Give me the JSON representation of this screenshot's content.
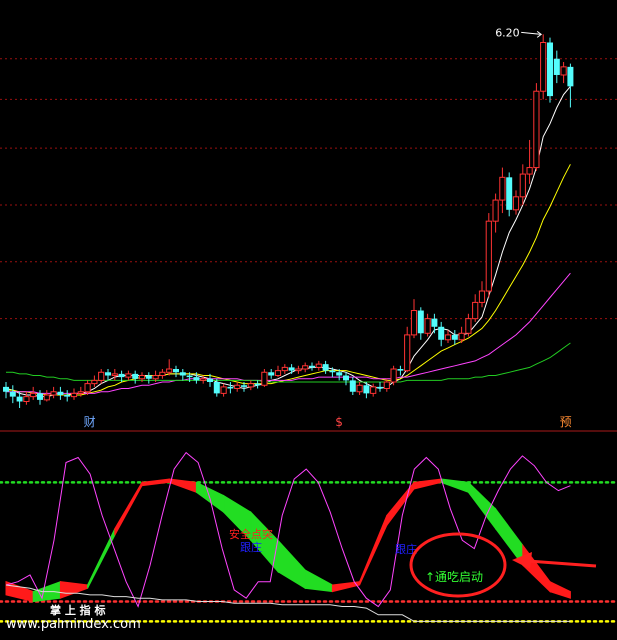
{
  "chart_data": [
    {
      "type": "candlestick",
      "title": "",
      "ylim": [
        3.9,
        6.35
      ],
      "y_gridlines": [
        4.45,
        4.8,
        5.15,
        5.5,
        5.8,
        6.05
      ],
      "high_label": "6.20",
      "candles": [
        [
          4.03,
          4.0,
          4.06,
          3.96
        ],
        [
          4.0,
          3.97,
          4.04,
          3.93
        ],
        [
          3.97,
          3.94,
          4.0,
          3.9
        ],
        [
          3.94,
          3.97,
          4.0,
          3.92
        ],
        [
          3.97,
          3.99,
          4.03,
          3.95
        ],
        [
          3.99,
          3.95,
          4.01,
          3.92
        ],
        [
          3.95,
          3.98,
          4.01,
          3.94
        ],
        [
          3.98,
          4.0,
          4.03,
          3.96
        ],
        [
          4.0,
          3.98,
          4.03,
          3.95
        ],
        [
          3.98,
          3.97,
          4.01,
          3.94
        ],
        [
          3.97,
          3.99,
          4.02,
          3.95
        ],
        [
          3.99,
          4.0,
          4.03,
          3.97
        ],
        [
          4.0,
          4.05,
          4.07,
          3.98
        ],
        [
          4.05,
          4.07,
          4.1,
          4.03
        ],
        [
          4.07,
          4.12,
          4.14,
          4.05
        ],
        [
          4.12,
          4.1,
          4.14,
          4.07
        ],
        [
          4.1,
          4.11,
          4.14,
          4.07
        ],
        [
          4.11,
          4.09,
          4.13,
          4.06
        ],
        [
          4.09,
          4.11,
          4.13,
          4.07
        ],
        [
          4.11,
          4.08,
          4.13,
          4.05
        ],
        [
          4.08,
          4.1,
          4.12,
          4.06
        ],
        [
          4.1,
          4.08,
          4.12,
          4.05
        ],
        [
          4.08,
          4.1,
          4.13,
          4.06
        ],
        [
          4.1,
          4.12,
          4.14,
          4.08
        ],
        [
          4.12,
          4.14,
          4.2,
          4.1
        ],
        [
          4.14,
          4.12,
          4.16,
          4.09
        ],
        [
          4.12,
          4.1,
          4.14,
          4.07
        ],
        [
          4.1,
          4.09,
          4.12,
          4.06
        ],
        [
          4.09,
          4.07,
          4.12,
          4.05
        ],
        [
          4.07,
          4.08,
          4.1,
          4.05
        ],
        [
          4.08,
          4.06,
          4.11,
          4.03
        ],
        [
          4.06,
          3.99,
          4.08,
          3.97
        ],
        [
          3.99,
          4.03,
          4.05,
          3.97
        ],
        [
          4.03,
          4.02,
          4.06,
          3.99
        ],
        [
          4.02,
          4.04,
          4.06,
          4.0
        ],
        [
          4.04,
          4.03,
          4.06,
          4.0
        ],
        [
          4.03,
          4.05,
          4.07,
          4.01
        ],
        [
          4.05,
          4.04,
          4.07,
          4.02
        ],
        [
          4.04,
          4.12,
          4.14,
          4.03
        ],
        [
          4.12,
          4.1,
          4.14,
          4.08
        ],
        [
          4.1,
          4.13,
          4.16,
          4.09
        ],
        [
          4.13,
          4.15,
          4.17,
          4.11
        ],
        [
          4.15,
          4.13,
          4.17,
          4.11
        ],
        [
          4.13,
          4.14,
          4.16,
          4.11
        ],
        [
          4.14,
          4.16,
          4.18,
          4.12
        ],
        [
          4.16,
          4.15,
          4.18,
          4.13
        ],
        [
          4.15,
          4.17,
          4.19,
          4.13
        ],
        [
          4.17,
          4.13,
          4.19,
          4.11
        ],
        [
          4.13,
          4.12,
          4.15,
          4.09
        ],
        [
          4.12,
          4.1,
          4.14,
          4.07
        ],
        [
          4.1,
          4.07,
          4.12,
          4.04
        ],
        [
          4.07,
          4.0,
          4.09,
          3.98
        ],
        [
          4.0,
          4.04,
          4.06,
          3.98
        ],
        [
          4.04,
          3.99,
          4.06,
          3.96
        ],
        [
          3.99,
          4.03,
          4.05,
          3.97
        ],
        [
          4.03,
          4.02,
          4.06,
          4.0
        ],
        [
          4.02,
          4.06,
          4.08,
          4.0
        ],
        [
          4.06,
          4.14,
          4.16,
          4.04
        ],
        [
          4.14,
          4.13,
          4.16,
          4.1
        ],
        [
          4.13,
          4.35,
          4.4,
          4.12
        ],
        [
          4.35,
          4.5,
          4.57,
          4.33
        ],
        [
          4.5,
          4.36,
          4.52,
          4.32
        ],
        [
          4.36,
          4.45,
          4.48,
          4.34
        ],
        [
          4.45,
          4.4,
          4.48,
          4.36
        ],
        [
          4.4,
          4.32,
          4.43,
          4.28
        ],
        [
          4.32,
          4.35,
          4.38,
          4.3
        ],
        [
          4.35,
          4.32,
          4.38,
          4.29
        ],
        [
          4.32,
          4.36,
          4.4,
          4.3
        ],
        [
          4.36,
          4.45,
          4.48,
          4.34
        ],
        [
          4.45,
          4.55,
          4.6,
          4.43
        ],
        [
          4.55,
          4.62,
          4.68,
          4.52
        ],
        [
          4.62,
          5.05,
          5.1,
          4.58
        ],
        [
          5.05,
          5.18,
          5.22,
          4.98
        ],
        [
          5.18,
          5.32,
          5.38,
          5.1
        ],
        [
          5.32,
          5.12,
          5.35,
          5.08
        ],
        [
          5.12,
          5.2,
          5.24,
          5.09
        ],
        [
          5.2,
          5.34,
          5.4,
          5.15
        ],
        [
          5.34,
          5.38,
          5.55,
          5.28
        ],
        [
          5.38,
          5.85,
          5.9,
          5.36
        ],
        [
          5.85,
          6.15,
          6.2,
          5.8
        ],
        [
          6.15,
          5.82,
          6.18,
          5.78
        ],
        [
          6.05,
          5.95,
          6.1,
          5.9
        ],
        [
          5.95,
          6.0,
          6.03,
          5.9
        ],
        [
          6.0,
          5.88,
          6.02,
          5.75
        ]
      ],
      "ma_lines": [
        {
          "color": "#ffffff",
          "values": [
            4.02,
            4.01,
            3.99,
            3.98,
            3.98,
            3.97,
            3.97,
            3.98,
            3.98,
            3.98,
            3.99,
            3.99,
            4.0,
            4.02,
            4.05,
            4.07,
            4.09,
            4.1,
            4.1,
            4.1,
            4.1,
            4.1,
            4.1,
            4.1,
            4.11,
            4.11,
            4.11,
            4.11,
            4.1,
            4.09,
            4.08,
            4.06,
            4.05,
            4.04,
            4.03,
            4.02,
            4.03,
            4.04,
            4.05,
            4.07,
            4.08,
            4.1,
            4.12,
            4.14,
            4.14,
            4.15,
            4.15,
            4.15,
            4.14,
            4.13,
            4.12,
            4.1,
            4.07,
            4.05,
            4.03,
            4.02,
            4.03,
            4.06,
            4.08,
            4.14,
            4.22,
            4.27,
            4.32,
            4.38,
            4.39,
            4.38,
            4.35,
            4.35,
            4.36,
            4.41,
            4.46,
            4.59,
            4.72,
            4.86,
            4.98,
            5.06,
            5.15,
            5.25,
            5.38,
            5.57,
            5.65,
            5.75,
            5.83,
            5.88
          ]
        },
        {
          "color": "#ffff00",
          "values": [
            4.01,
            4.01,
            4.0,
            4.0,
            3.99,
            3.99,
            3.98,
            3.98,
            3.98,
            3.98,
            3.98,
            3.98,
            3.99,
            4.0,
            4.01,
            4.03,
            4.04,
            4.06,
            4.07,
            4.08,
            4.09,
            4.1,
            4.1,
            4.1,
            4.11,
            4.11,
            4.11,
            4.11,
            4.11,
            4.1,
            4.1,
            4.09,
            4.08,
            4.07,
            4.06,
            4.05,
            4.05,
            4.05,
            4.05,
            4.05,
            4.06,
            4.07,
            4.08,
            4.09,
            4.1,
            4.11,
            4.12,
            4.13,
            4.13,
            4.13,
            4.13,
            4.12,
            4.11,
            4.1,
            4.09,
            4.08,
            4.07,
            4.07,
            4.08,
            4.1,
            4.13,
            4.16,
            4.19,
            4.22,
            4.25,
            4.27,
            4.29,
            4.31,
            4.33,
            4.36,
            4.39,
            4.44,
            4.5,
            4.57,
            4.64,
            4.71,
            4.78,
            4.86,
            4.95,
            5.06,
            5.14,
            5.23,
            5.32,
            5.4
          ]
        },
        {
          "color": "#ff44ff",
          "values": [
            4.0,
            4.0,
            4.0,
            4.0,
            4.0,
            3.99,
            3.99,
            3.99,
            3.99,
            3.99,
            3.99,
            3.99,
            3.99,
            3.99,
            4.0,
            4.0,
            4.01,
            4.02,
            4.02,
            4.03,
            4.04,
            4.04,
            4.05,
            4.06,
            4.06,
            4.07,
            4.07,
            4.08,
            4.08,
            4.08,
            4.08,
            4.08,
            4.08,
            4.08,
            4.08,
            4.07,
            4.07,
            4.07,
            4.07,
            4.07,
            4.07,
            4.07,
            4.07,
            4.08,
            4.08,
            4.08,
            4.09,
            4.09,
            4.09,
            4.09,
            4.09,
            4.09,
            4.09,
            4.09,
            4.08,
            4.08,
            4.08,
            4.08,
            4.09,
            4.09,
            4.1,
            4.11,
            4.12,
            4.13,
            4.14,
            4.15,
            4.16,
            4.17,
            4.18,
            4.19,
            4.21,
            4.23,
            4.26,
            4.29,
            4.32,
            4.35,
            4.39,
            4.43,
            4.48,
            4.53,
            4.58,
            4.63,
            4.68,
            4.73
          ]
        },
        {
          "color": "#22cc22",
          "values": [
            4.12,
            4.12,
            4.11,
            4.11,
            4.1,
            4.1,
            4.09,
            4.09,
            4.08,
            4.08,
            4.07,
            4.07,
            4.07,
            4.07,
            4.07,
            4.07,
            4.07,
            4.07,
            4.07,
            4.07,
            4.07,
            4.07,
            4.07,
            4.07,
            4.07,
            4.07,
            4.07,
            4.07,
            4.07,
            4.07,
            4.07,
            4.07,
            4.07,
            4.07,
            4.07,
            4.07,
            4.07,
            4.07,
            4.06,
            4.06,
            4.06,
            4.06,
            4.06,
            4.06,
            4.06,
            4.06,
            4.06,
            4.06,
            4.06,
            4.06,
            4.06,
            4.06,
            4.06,
            4.06,
            4.06,
            4.06,
            4.06,
            4.06,
            4.06,
            4.07,
            4.07,
            4.07,
            4.07,
            4.07,
            4.07,
            4.08,
            4.08,
            4.08,
            4.08,
            4.09,
            4.09,
            4.1,
            4.1,
            4.11,
            4.12,
            4.13,
            4.14,
            4.15,
            4.17,
            4.19,
            4.21,
            4.24,
            4.27,
            4.3
          ]
        }
      ],
      "markers": [
        {
          "index": 12,
          "text": "财",
          "color": "#6fa8ff"
        },
        {
          "index": 49,
          "text": "$",
          "color": "#ff4444"
        },
        {
          "index": 82,
          "text": "预",
          "color": "#ff8c32"
        }
      ]
    },
    {
      "type": "indicator",
      "ylim": [
        -8,
        108
      ],
      "dotted_levels": [
        {
          "value": 80,
          "color": "#22dd22"
        },
        {
          "value": 8,
          "color": "#ff3030"
        },
        {
          "value": -4,
          "color": "#ffff00"
        }
      ],
      "band_x": [
        0,
        4,
        8,
        12,
        16,
        20,
        24,
        28,
        32,
        36,
        40,
        44,
        48,
        52,
        56,
        60,
        64,
        68,
        72,
        76,
        80,
        83
      ],
      "band_upper": [
        20,
        14,
        20,
        18,
        52,
        80,
        82,
        80,
        72,
        62,
        45,
        27,
        18,
        20,
        60,
        80,
        82,
        80,
        64,
        42,
        20,
        14
      ],
      "band_lower": [
        12,
        8,
        10,
        16,
        48,
        78,
        80,
        74,
        62,
        45,
        26,
        16,
        14,
        18,
        54,
        76,
        80,
        74,
        52,
        30,
        14,
        10
      ],
      "band_colors": [
        "red",
        "green",
        "red",
        "green",
        "red",
        "red",
        "red",
        "green",
        "green",
        "green",
        "green",
        "green",
        "red",
        "red",
        "red",
        "red",
        "green",
        "green",
        "green",
        "red",
        "red",
        "green"
      ],
      "line_magenta": [
        18,
        20,
        24,
        10,
        45,
        92,
        95,
        85,
        60,
        40,
        20,
        5,
        30,
        60,
        88,
        98,
        92,
        70,
        40,
        15,
        10,
        20,
        20,
        60,
        82,
        88,
        80,
        62,
        40,
        20,
        10,
        5,
        15,
        60,
        88,
        95,
        88,
        64,
        45,
        40,
        60,
        75,
        88,
        96,
        90,
        80,
        75,
        78
      ],
      "line_white": [
        18,
        17,
        16,
        14,
        14,
        13,
        13,
        12,
        12,
        11,
        11,
        10,
        10,
        9,
        9,
        9,
        8,
        8,
        8,
        7,
        7,
        7,
        7,
        6,
        6,
        6,
        6,
        6,
        5,
        5,
        4,
        0,
        0,
        0,
        -4,
        -4,
        -4,
        -4,
        -4,
        -4,
        -4,
        -4,
        -4,
        -4,
        -4,
        -4,
        -4,
        -4
      ],
      "labels": [
        {
          "text": "安全点突",
          "color": "#ff2020"
        },
        {
          "text": "跟庄",
          "color": "#2020ff"
        },
        {
          "text": "跟庄",
          "color": "#2020ff"
        },
        {
          "text": "↑通吃启动",
          "color": "#33ff33"
        },
        {
          "text": "掌 上 指 标",
          "color": "#ffffff"
        }
      ],
      "watermark": "www.palmindex.com"
    }
  ],
  "colors": {
    "up": "#ff3333",
    "down": "#54fcfc",
    "grid": "#9a1010",
    "divider": "#aa1a1a",
    "annotation": "#ff2020"
  }
}
